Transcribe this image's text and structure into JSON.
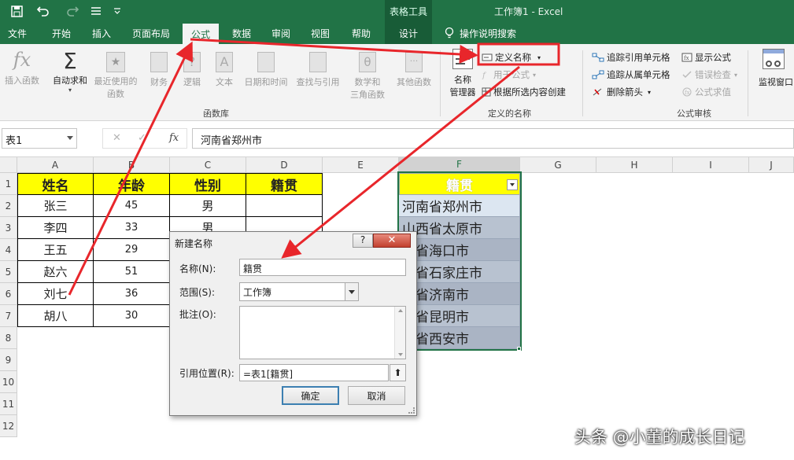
{
  "titlebar": {
    "tool_context": "表格工具",
    "title": "工作簿1  -  Excel"
  },
  "tabs": [
    {
      "label": "文件"
    },
    {
      "label": "开始"
    },
    {
      "label": "插入"
    },
    {
      "label": "页面布局"
    },
    {
      "label": "公式",
      "active": true
    },
    {
      "label": "数据"
    },
    {
      "label": "审阅"
    },
    {
      "label": "视图"
    },
    {
      "label": "帮助"
    },
    {
      "label": "设计"
    }
  ],
  "tell_me": "操作说明搜索",
  "ribbon": {
    "insert_function": "插入函数",
    "autosum": "自动求和",
    "recent_1": "最近使用的",
    "recent_2": "函数",
    "financial": "财务",
    "logical": "逻辑",
    "text": "文本",
    "datetime": "日期和时间",
    "lookup": "查找与引用",
    "math_1": "数学和",
    "math_2": "三角函数",
    "other": "其他函数",
    "group_library": "函数库",
    "name_manager_1": "名称",
    "name_manager_2": "管理器",
    "define_name": "定义名称",
    "use_in_formula": "用于公式",
    "create_from_sel": "根据所选内容创建",
    "group_names": "定义的名称",
    "trace_precedents": "追踪引用单元格",
    "trace_dependents": "追踪从属单元格",
    "remove_arrows": "删除箭头",
    "show_formulas": "显示公式",
    "error_check": "错误检查",
    "evaluate": "公式求值",
    "group_audit": "公式审核",
    "watch_1": "监视窗口"
  },
  "formula_bar": {
    "name_box": "表1",
    "formula": "河南省郑州市"
  },
  "columns": [
    "A",
    "B",
    "C",
    "D",
    "E",
    "F",
    "G",
    "H",
    "I",
    "J"
  ],
  "rows": [
    "1",
    "2",
    "3",
    "4",
    "5",
    "6",
    "7",
    "8",
    "9",
    "10",
    "11",
    "12"
  ],
  "table": {
    "headers": [
      "姓名",
      "年龄",
      "性别",
      "籍贯"
    ],
    "rows": [
      [
        "张三",
        "45",
        "男",
        ""
      ],
      [
        "李四",
        "33",
        "男",
        ""
      ],
      [
        "王五",
        "29",
        "",
        ""
      ],
      [
        "赵六",
        "51",
        "",
        ""
      ],
      [
        "刘七",
        "36",
        "",
        ""
      ],
      [
        "胡八",
        "30",
        "",
        ""
      ]
    ]
  },
  "list": {
    "header": "籍贯",
    "values": [
      "河南省郑州市",
      "山西省太原市",
      "南省海口市",
      "北省石家庄市",
      "东省济南市",
      "南省昆明市",
      "西省西安市"
    ]
  },
  "dialog": {
    "title": "新建名称",
    "help": "?",
    "close": "✕",
    "name_label": "名称(N):",
    "name_value": "籍贯",
    "scope_label": "范围(S):",
    "scope_value": "工作簿",
    "comment_label": "批注(O):",
    "ref_label": "引用位置(R):",
    "ref_value": "=表1[籍贯]",
    "ok": "确定",
    "cancel": "取消"
  },
  "watermark": "头条 @小董的成长日记",
  "colors": {
    "excel_green": "#217346",
    "header_yellow": "#ffff00",
    "annotation_red": "#e8262b"
  }
}
